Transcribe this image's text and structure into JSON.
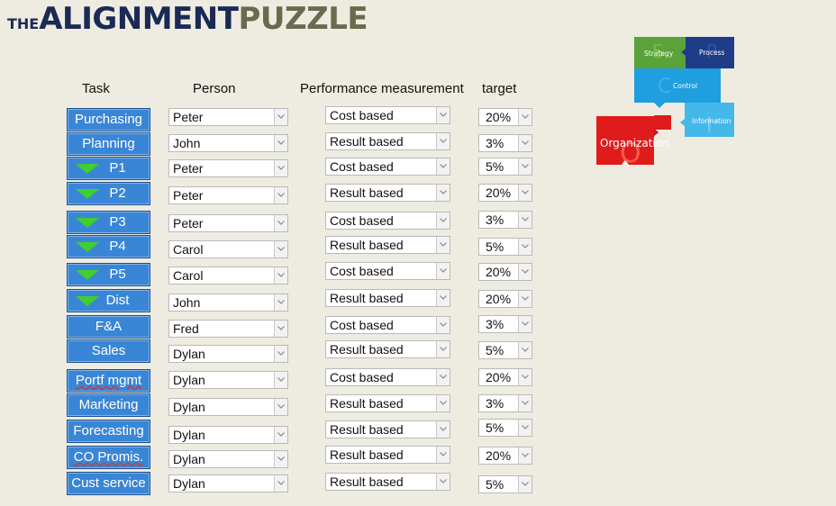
{
  "title": {
    "small": "THE",
    "part1": "ALIGNMENT",
    "part2": "PUZZLE"
  },
  "headers": {
    "task": "Task",
    "person": "Person",
    "perf": "Performance measurement",
    "target": "target"
  },
  "rows": [
    {
      "task": "Purchasing",
      "arrow": false,
      "person": "Peter",
      "perf": "Cost based",
      "target": "20%"
    },
    {
      "task": "Planning",
      "arrow": false,
      "person": "John",
      "perf": "Result based",
      "target": "3%"
    },
    {
      "task": "P1",
      "arrow": true,
      "person": "Peter",
      "perf": "Cost based",
      "target": "5%"
    },
    {
      "task": "P2",
      "arrow": true,
      "person": "Peter",
      "perf": "Result based",
      "target": "20%"
    },
    {
      "task": "P3",
      "arrow": true,
      "person": "Peter",
      "perf": "Cost based",
      "target": "3%"
    },
    {
      "task": "P4",
      "arrow": true,
      "person": "Carol",
      "perf": "Result based",
      "target": "5%"
    },
    {
      "task": "P5",
      "arrow": true,
      "person": "Carol",
      "perf": "Cost based",
      "target": "20%"
    },
    {
      "task": "Dist",
      "arrow": true,
      "person": "John",
      "perf": "Result based",
      "target": "20%"
    },
    {
      "task": "F&A",
      "arrow": false,
      "person": "Fred",
      "perf": "Cost based",
      "target": "3%"
    },
    {
      "task": "Sales",
      "arrow": false,
      "person": "Dylan",
      "perf": "Result based",
      "target": "5%"
    },
    {
      "task": "Portf mgmt",
      "arrow": false,
      "person": "Dylan",
      "perf": "Cost based",
      "target": "20%"
    },
    {
      "task": "Marketing",
      "arrow": false,
      "person": "Dylan",
      "perf": "Result based",
      "target": "3%"
    },
    {
      "task": "Forecasting",
      "arrow": false,
      "person": "Dylan",
      "perf": "Result based",
      "target": "5%"
    },
    {
      "task": "CO Promis.",
      "arrow": false,
      "person": "Dylan",
      "perf": "Result based",
      "target": "20%"
    },
    {
      "task": "Cust service",
      "arrow": false,
      "person": "Dylan",
      "perf": "Result based",
      "target": "5%"
    }
  ],
  "puzzle": {
    "strategy": "Strategy",
    "process": "Process",
    "control": "Control",
    "information": "Information",
    "organization": "Organization",
    "letters": {
      "s": "S",
      "p": "P",
      "c": "C",
      "i": "I",
      "o": "O"
    },
    "colors": {
      "strategy": "#5aa33a",
      "process": "#1f3c88",
      "control": "#1f9ee0",
      "information": "#45b8ea",
      "organization": "#e01b1b"
    }
  }
}
